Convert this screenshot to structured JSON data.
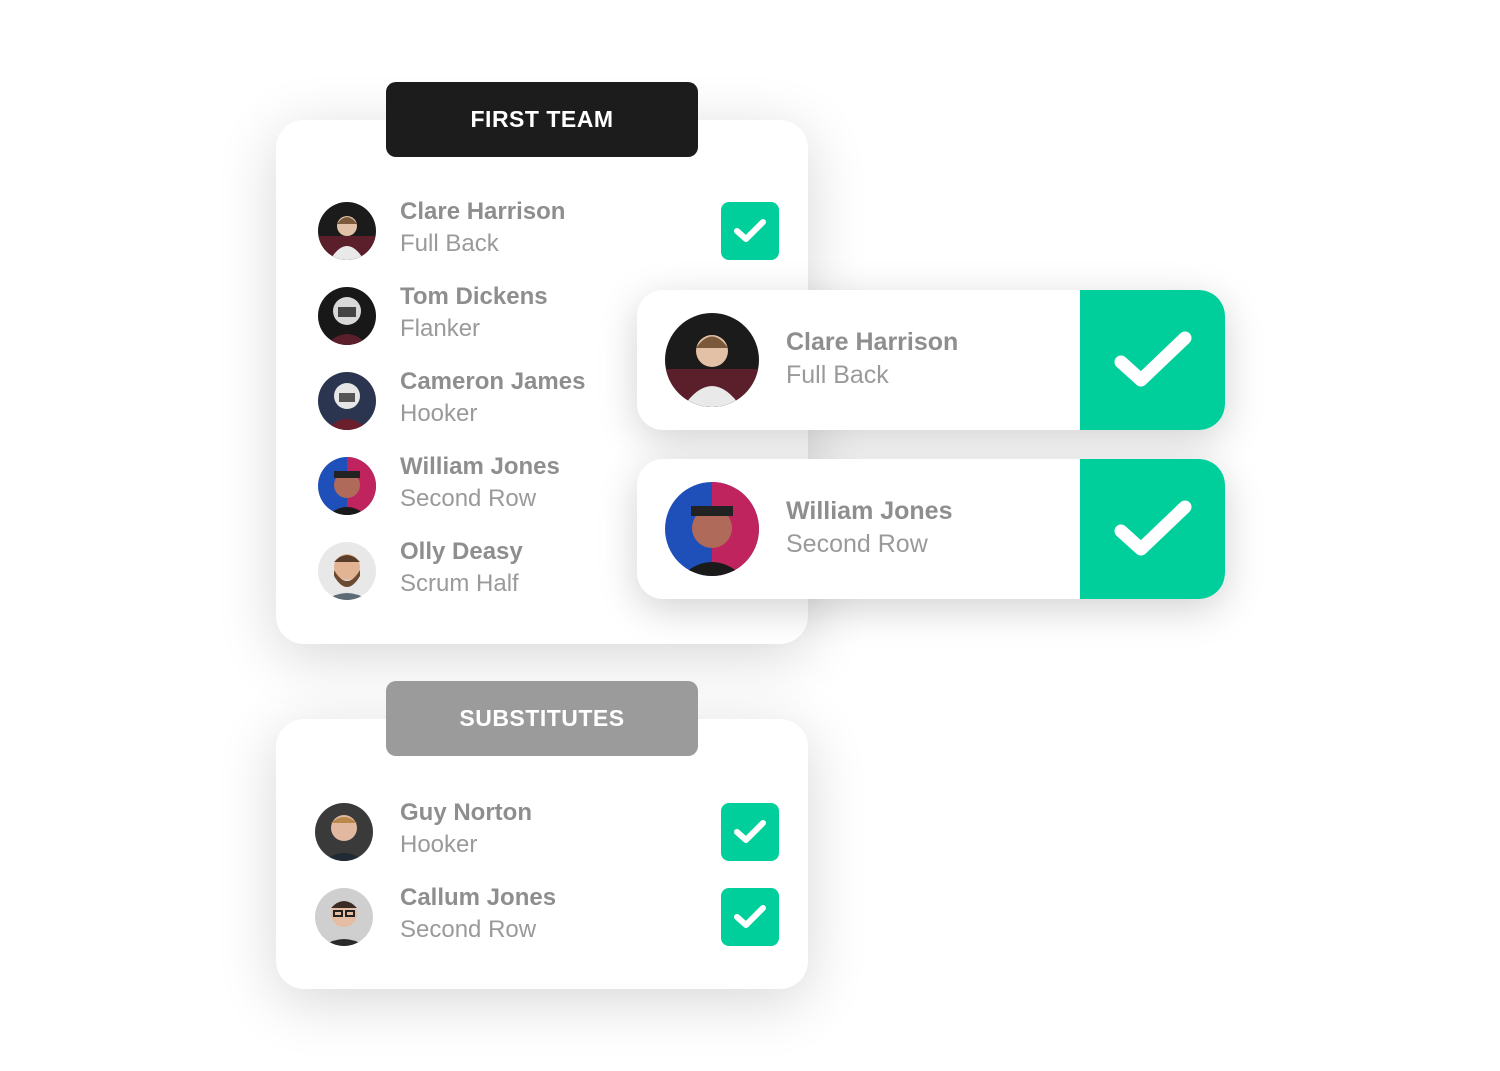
{
  "first_team": {
    "title": "FIRST TEAM",
    "players": [
      {
        "name": "Clare Harrison",
        "position": "Full Back",
        "selected": true
      },
      {
        "name": "Tom Dickens",
        "position": "Flanker",
        "selected": false
      },
      {
        "name": "Cameron James",
        "position": "Hooker",
        "selected": false
      },
      {
        "name": "William Jones",
        "position": "Second Row",
        "selected": false
      },
      {
        "name": "Olly Deasy",
        "position": "Scrum Half",
        "selected": false
      }
    ]
  },
  "substitutes": {
    "title": "SUBSTITUTES",
    "players": [
      {
        "name": "Guy Norton",
        "position": "Hooker",
        "selected": true
      },
      {
        "name": "Callum Jones",
        "position": "Second Row",
        "selected": true
      }
    ]
  },
  "selected_cards": [
    {
      "name": "Clare Harrison",
      "position": "Full Back"
    },
    {
      "name": "William Jones",
      "position": "Second Row"
    }
  ],
  "colors": {
    "accent": "#00cf9c",
    "dark_tab": "#1c1c1c",
    "grey_tab": "#9b9b9b",
    "text": "#8e8e8e"
  },
  "icons": {
    "check": "check-icon"
  }
}
